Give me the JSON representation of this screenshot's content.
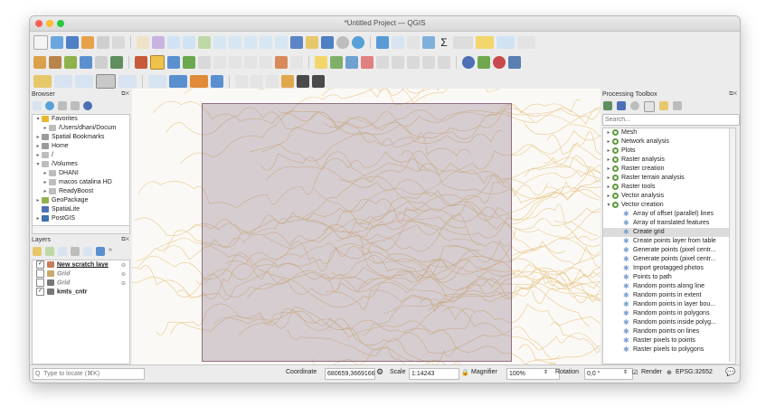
{
  "window": {
    "title": "*Untitled Project — QGIS"
  },
  "browser": {
    "title": "Browser",
    "items": [
      {
        "label": "Favorites",
        "twisty": "▾",
        "color": "#e9b82f"
      },
      {
        "label": "/Users/dhani/Docum",
        "twisty": "▸",
        "color": "#bdbdbd"
      },
      {
        "label": "Spatial Bookmarks",
        "twisty": "▸",
        "color": "#9b9b9b"
      },
      {
        "label": "Home",
        "twisty": "▸",
        "color": "#9b9b9b"
      },
      {
        "label": "/",
        "twisty": "▸",
        "color": "#bdbdbd"
      },
      {
        "label": "/Volumes",
        "twisty": "▾",
        "color": "#bdbdbd"
      },
      {
        "label": "DHANI",
        "twisty": "▸",
        "color": "#bdbdbd"
      },
      {
        "label": "macos catalina HD",
        "twisty": "▸",
        "color": "#bdbdbd"
      },
      {
        "label": "ReadyBoost",
        "twisty": "▸",
        "color": "#bdbdbd"
      },
      {
        "label": "GeoPackage",
        "twisty": "▸",
        "color": "#8fb24a"
      },
      {
        "label": "SpatiaLite",
        "twisty": "",
        "color": "#4d6fb5"
      },
      {
        "label": "PostGIS",
        "twisty": "▸",
        "color": "#3d6fb1"
      }
    ]
  },
  "layers": {
    "title": "Layers",
    "items": [
      {
        "label": "New scratch laye",
        "checked": "✓",
        "style": "bold-underline",
        "color": "#c97b5b"
      },
      {
        "label": "Grid",
        "checked": "",
        "style": "italic-grey",
        "color": "#c9a96b"
      },
      {
        "label": "Grid",
        "checked": "",
        "style": "italic-grey",
        "color": "#777777"
      },
      {
        "label": "kmts_cntr",
        "checked": "✓",
        "style": "bold",
        "color": "#777777"
      }
    ]
  },
  "processing": {
    "title": "Processing Toolbox",
    "search_placeholder": "Search...",
    "groups": [
      {
        "label": "Mesh",
        "twisty": "▸"
      },
      {
        "label": "Network analysis",
        "twisty": "▸"
      },
      {
        "label": "Plots",
        "twisty": "▸"
      },
      {
        "label": "Raster analysis",
        "twisty": "▸"
      },
      {
        "label": "Raster creation",
        "twisty": "▸"
      },
      {
        "label": "Raster terrain analysis",
        "twisty": "▸"
      },
      {
        "label": "Raster tools",
        "twisty": "▸"
      },
      {
        "label": "Vector analysis",
        "twisty": "▸"
      },
      {
        "label": "Vector creation",
        "twisty": "▾"
      }
    ],
    "tools": [
      "Array of offset (parallel) lines",
      "Array of translated features",
      "Create grid",
      "Create points layer from table",
      "Generate points (pixel centr...",
      "Generate points (pixel centr...",
      "Import geotagged photos",
      "Points to path",
      "Random points along line",
      "Random points in extent",
      "Random points in layer bou...",
      "Random points in polygons",
      "Random points inside polyg...",
      "Random points on lines",
      "Raster pixels to points",
      "Raster pixels to polygons"
    ],
    "selected_tool": "Create grid"
  },
  "status": {
    "locate_placeholder": "Q  Type to locate (⌘K)",
    "coordinate_label": "Coordinate",
    "coordinate_value": "680659,3669166",
    "scale_label": "Scale",
    "scale_value": "1:14243",
    "magnifier_label": "Magnifier",
    "magnifier_value": "100%",
    "rotation_label": "Rotation",
    "rotation_value": "0,0 °",
    "render_label": "Render",
    "crs_label": "EPSG:32652"
  },
  "colors": {
    "contour": "#e8c98f",
    "grid_fill": "#8a6d84",
    "selection": "#dcdcdc"
  }
}
